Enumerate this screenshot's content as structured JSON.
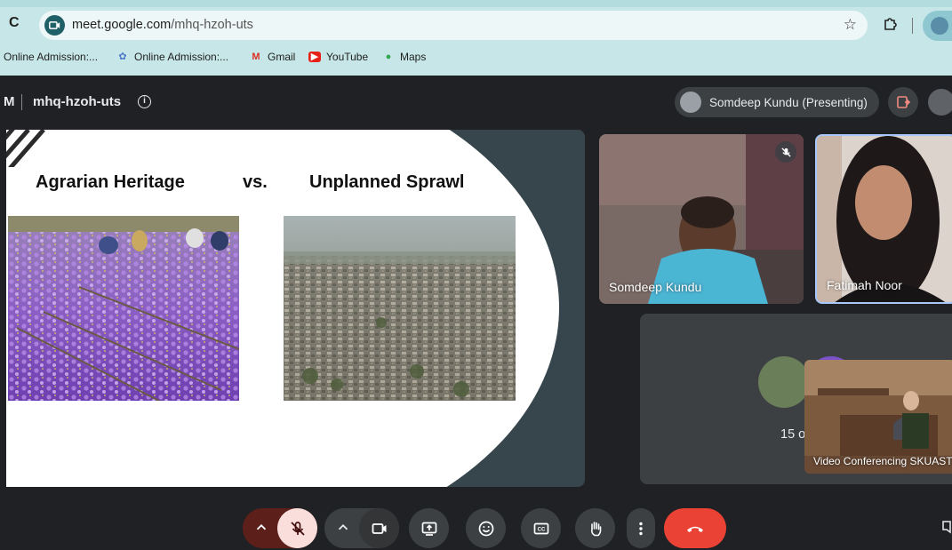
{
  "browser": {
    "url_host": "meet.google.com",
    "url_path": "/mhq-hzoh-uts",
    "bookmarks": [
      {
        "label": "Online Admission:...",
        "icon": "bookmark-page-icon"
      },
      {
        "label": "Online Admission:...",
        "icon": "admission-portal-icon"
      },
      {
        "label": "Gmail",
        "icon": "gmail-icon"
      },
      {
        "label": "YouTube",
        "icon": "youtube-icon"
      },
      {
        "label": "Maps",
        "icon": "maps-icon"
      }
    ]
  },
  "meeting": {
    "left_fragment": "M",
    "code": "mhq-hzoh-uts",
    "presenter_chip": "Somdeep Kundu (Presenting)"
  },
  "slide": {
    "left_title": "Agrarian Heritage",
    "vs": "vs.",
    "right_title": "Unplanned Sprawl",
    "left_image": "saffron-field-photo",
    "right_image": "city-sprawl-photo"
  },
  "participants": {
    "tile1_name": "Somdeep Kundu",
    "tile1_muted": true,
    "tile2_name": "Fatimah Noor",
    "others_count_text": "15 o",
    "vc_name": "Video Conferencing SKUAST-"
  },
  "controls": {
    "icons": [
      "chevron-up-icon",
      "mic-off-icon",
      "chevron-up-icon",
      "camera-icon",
      "present-screen-icon",
      "emoji-icon",
      "captions-icon",
      "raise-hand-icon",
      "more-vert-icon",
      "end-call-icon",
      "chat-icon"
    ]
  },
  "colors": {
    "browser_bar": "#c7e6e7",
    "meet_bg": "#202124",
    "button_bg": "#3c4043",
    "end_call": "#ea4335",
    "mic_muted_bg": "#f9dedc",
    "mic_group_bg": "#5c1f1a",
    "active_speaker_border": "#a8c7fa"
  }
}
